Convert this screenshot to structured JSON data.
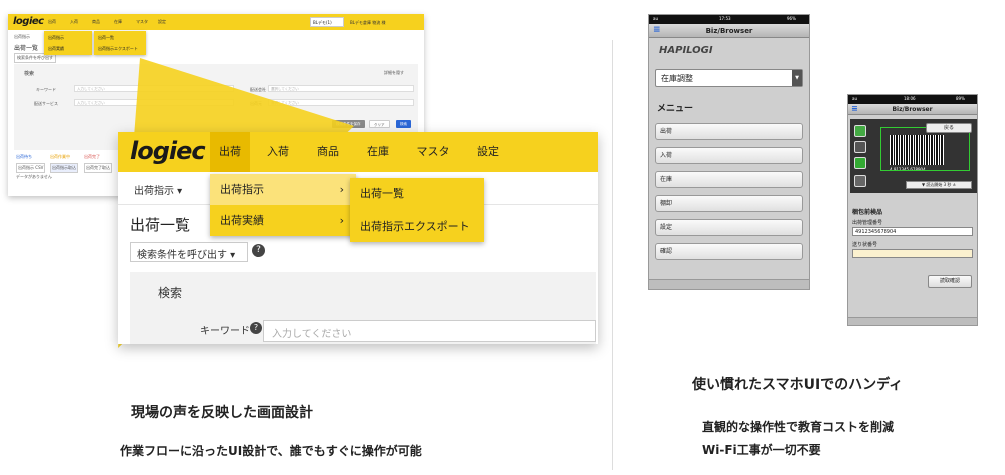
{
  "mini": {
    "logo": "logiec",
    "nav": [
      "出荷",
      "入荷",
      "商品",
      "在庫",
      "マスタ",
      "設定"
    ],
    "user_select": "BLデモ(1)",
    "user_name": "BLデモ倉庫 物流 様",
    "breadcrumb": "出荷指示",
    "page_title": "出荷一覧",
    "saved_search": "検索条件を呼び出す",
    "search_heading": "検索",
    "toggle_link": "詳細を隠す",
    "rows": [
      {
        "label": "キーワード",
        "placeholder": "入力してください",
        "label2": "配送会社",
        "placeholder2": "選択してください"
      },
      {
        "label": "配送サービス",
        "placeholder": "入力してください",
        "label2": "出荷元",
        "placeholder2": "選択してください"
      }
    ],
    "buttons": [
      "検索条件を保存",
      "クリア",
      "検索"
    ],
    "status_tabs": [
      "出荷待ち",
      "出荷作業中",
      "出荷完了"
    ],
    "status_btns": [
      "出荷指示 CSV",
      "出荷指示取込",
      "出荷完了取込"
    ],
    "empty_text": "データがありません",
    "dropdown1": [
      "出荷指示",
      "出荷実績"
    ],
    "dropdown2": [
      "出荷一覧",
      "出荷指示エクスポート"
    ]
  },
  "zoom": {
    "logo": "logiec",
    "nav": [
      "出荷",
      "入荷",
      "商品",
      "在庫",
      "マスタ",
      "設定"
    ],
    "sub_nav": "出荷指示 ▾",
    "dropdown1": [
      "出荷指示",
      "出荷実績"
    ],
    "dropdown2": [
      "出荷一覧",
      "出荷指示エクスポート"
    ],
    "page_title": "出荷一覧",
    "saved_search": "検索条件を呼び出す ▾",
    "help": "?",
    "panel_heading": "検索",
    "keyword_label": "キーワード",
    "keyword_placeholder": "入力してください"
  },
  "left_caption": {
    "title": "現場の声を反映した画面設計",
    "body": "作業フローに沿ったUI設計で、誰でもすぐに操作が可能"
  },
  "phone1": {
    "status_time": "17:53",
    "status_signal": "au",
    "status_batt": "96%",
    "title": "Biz/Browser",
    "brand": "HAPILOGI",
    "select_value": "在庫調整",
    "menu_heading": "メニュー",
    "menu": [
      "出荷",
      "入荷",
      "在庫",
      "棚卸",
      "設定",
      "確認"
    ]
  },
  "phone2": {
    "status_time": "18:06",
    "status_signal": "au",
    "status_batt": "89%",
    "title": "Biz/Browser",
    "back_button": "戻る",
    "barcode_digits": "4 912345 678904",
    "scan_bar": "▼ 読込開始 3 秒 ±",
    "section_title": "梱包前検品",
    "field1_label": "出荷管理番号",
    "field1_value": "4912345678904",
    "field2_label": "送り状番号",
    "field2_value": "",
    "read_button": "読取確認"
  },
  "right_caption": {
    "title": "使い慣れたスマホUIでのハンディ",
    "line1": "直観的な操作性で教育コストを削減",
    "line2": "Wi-Fi工事が一切不要"
  },
  "colors": {
    "accent": "#f6d11e",
    "accent_dark": "#e8ba00",
    "link": "#2a66d6"
  }
}
